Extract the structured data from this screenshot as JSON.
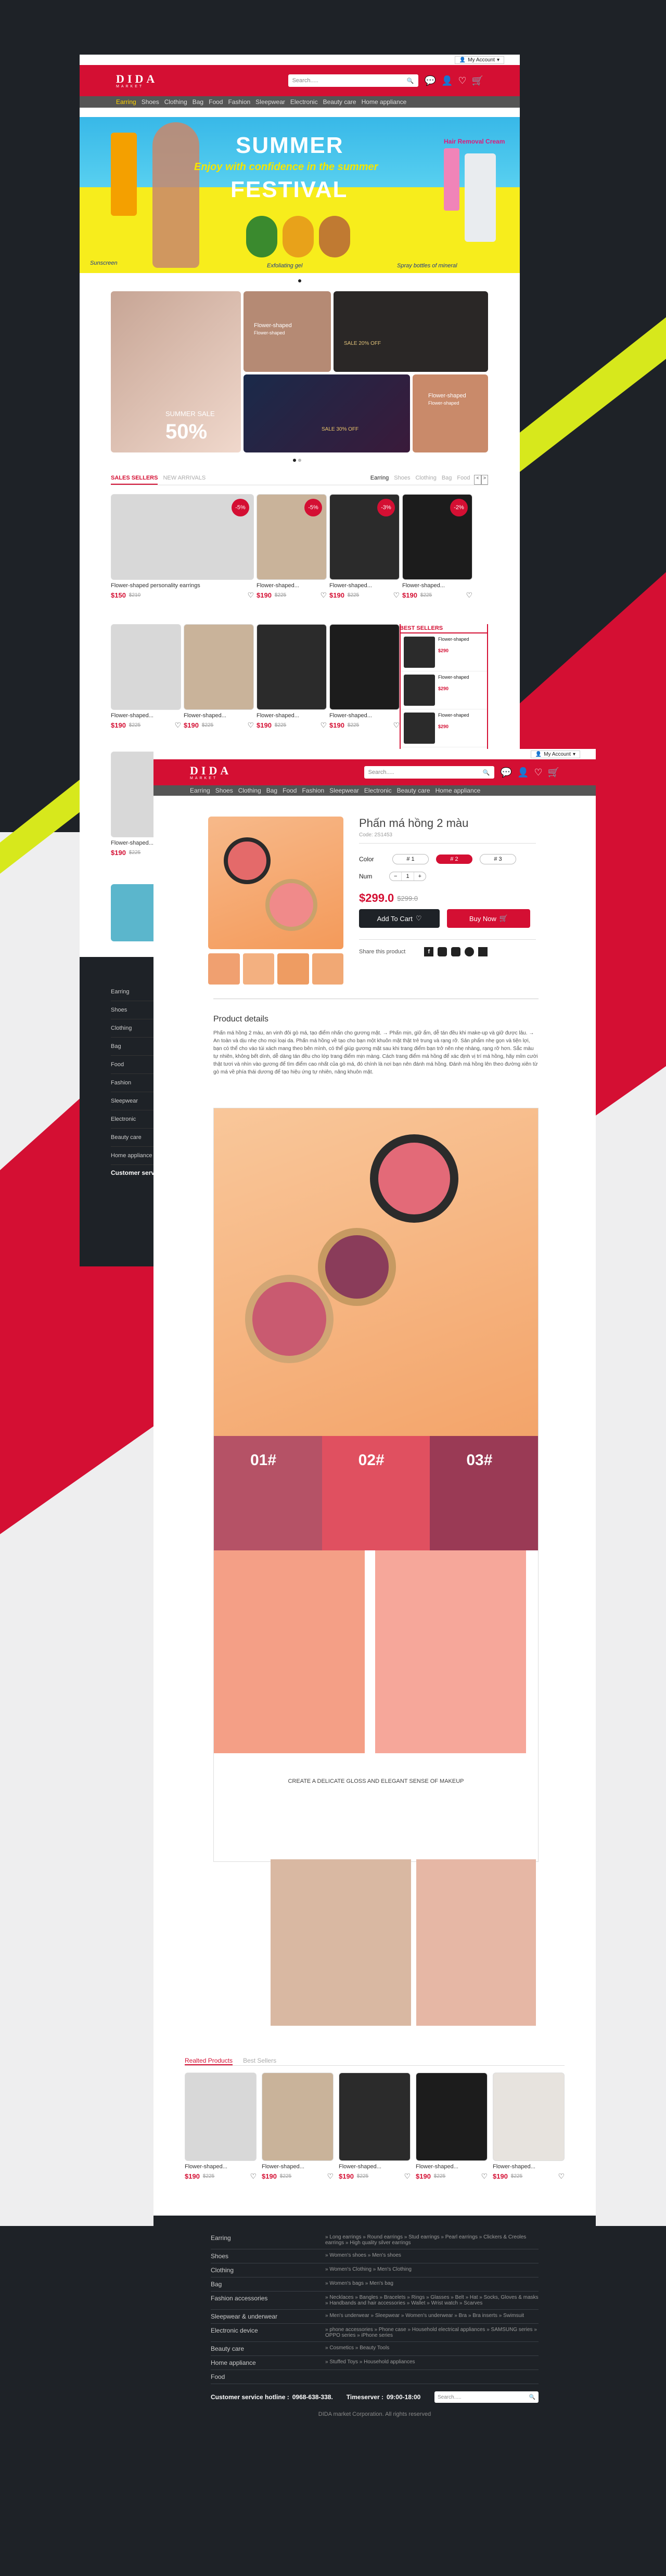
{
  "colors": {
    "brand": "#d40f33",
    "dark": "#1e2227",
    "nav": "#555555",
    "accent": "#ffd400"
  },
  "account": {
    "label": "My Account"
  },
  "logo": {
    "main": "DIDA",
    "sub": "MARKET"
  },
  "search": {
    "placeholder": "Search....."
  },
  "nav_items": [
    "Earring",
    "Shoes",
    "Clothing",
    "Bag",
    "Food",
    "Fashion",
    "Sleepwear",
    "Electronic",
    "Beauty care",
    "Home appliance"
  ],
  "icons": [
    "chat-icon",
    "user-icon",
    "heart-icon",
    "cart-icon",
    "search-icon"
  ],
  "banner": {
    "title1": "SUMMER",
    "subtitle": "Enjoy with confidence in the summer",
    "title2": "FESTIVAL",
    "right_caption": "Hair Removal Cream",
    "cap1": "Sunscreen",
    "cap2": "Exfoliating gel",
    "cap3": "Spray bottles of mineral"
  },
  "promos": {
    "summer_label": "SUMMER SALE",
    "summer_pct": "50%",
    "p2_title": "Flower-shaped",
    "p2_sub": "Flower-shaped",
    "p3": "SALE 20% OFF",
    "p4": "SALE 30% OFF",
    "p5_title": "Flower-shaped",
    "p5_sub": "Flower-shaped"
  },
  "home_tabs": {
    "left": [
      "SALES SELLERS",
      "NEW ARRIVALS"
    ],
    "right": [
      "Earring",
      "Shoes",
      "Clothing",
      "Bag",
      "Food"
    ]
  },
  "home_products": [
    {
      "name": "Flower-shaped personality earrings",
      "price": "$150",
      "old": "$210",
      "sale": "-5%"
    },
    {
      "name": "Flower-shaped...",
      "price": "$190",
      "old": "$225",
      "sale": "-5%"
    },
    {
      "name": "Flower-shaped...",
      "price": "$190",
      "old": "$225",
      "sale": "-3%"
    },
    {
      "name": "Flower-shaped...",
      "price": "$190",
      "old": "$225",
      "sale": "-2%"
    }
  ],
  "home_products2": [
    {
      "name": "Flower-shaped...",
      "price": "$190",
      "old": "$225"
    },
    {
      "name": "Flower-shaped...",
      "price": "$190",
      "old": "$225"
    },
    {
      "name": "Flower-shaped...",
      "price": "$190",
      "old": "$225"
    },
    {
      "name": "Flower-shaped...",
      "price": "$190",
      "old": "$225"
    }
  ],
  "home_products3": [
    {
      "name": "Flower-shaped...",
      "price": "$190",
      "old": "$225"
    }
  ],
  "best_sellers": {
    "title": "BEST SELLERS",
    "items": [
      {
        "name": "Flower-shaped",
        "price": "$290"
      },
      {
        "name": "Flower-shaped",
        "price": "$290"
      },
      {
        "name": "Flower-shaped",
        "price": "$290"
      }
    ]
  },
  "home_footer_cats": [
    "Earring",
    "Shoes",
    "Clothing",
    "Bag",
    "Food",
    "Fashion",
    "Sleepwear",
    "Electronic",
    "Beauty care",
    "Home appliance"
  ],
  "home_footer_hotline": "Customer service hotline",
  "product": {
    "name": "Phấn má hồng 2 màu",
    "code": "Code: 2S1453",
    "color_label": "Color",
    "colors": [
      "# 1",
      "# 2",
      "# 3"
    ],
    "num_label": "Num",
    "qty": "1",
    "price": "$299.0",
    "old": "$299.0",
    "add_to_cart": "Add To Cart",
    "buy_now": "Buy Now",
    "share": "Share this product",
    "details_title": "Product details",
    "details_text": "Phấn má hồng 2 màu, an vinh đôi gò má, tạo điểm nhấn cho gương mặt. → Phấn mịn, giữ ẩm, dễ tán đều khi make-up và giữ được lâu. → An toàn và dịu nhẹ cho mọi loại da. Phấn má hồng về tạo cho bạn một khuôn mặt thật trẻ trung và rạng rỡ. Sản phẩm nhẹ gọn và tiện lợi, bạn có thể cho vào túi xách mang theo bên mình, có thể giúp gương mặt sau khi trang điểm bạn trở nên nhẹ nhàng, rạng rỡ hơn. Sắc màu tự nhiên, không bết dính, dễ dàng tán đều cho lớp trang điểm mịn màng. Cách trang điểm má hồng để xác định vị trí má hồng, hãy mỉm cười thật tươi và nhìn vào gương để tìm điểm cao nhất của gò má, đó chính là nơi bạn nên đánh má hồng. Đánh má hồng lên theo đường xiên từ gò má về phía thái dương để tạo hiệu ứng tự nhiên, nâng khuôn mặt.",
    "swatches": [
      "01#",
      "02#",
      "03#"
    ],
    "caption": "CREATE A DELICATE GLOSS AND ELEGANT SENSE OF MAKEUP"
  },
  "related_tabs": [
    "Realted Products",
    "Best Sellers"
  ],
  "related": [
    {
      "name": "Flower-shaped...",
      "price": "$190",
      "old": "$225"
    },
    {
      "name": "Flower-shaped...",
      "price": "$190",
      "old": "$225"
    },
    {
      "name": "Flower-shaped...",
      "price": "$190",
      "old": "$225"
    },
    {
      "name": "Flower-shaped...",
      "price": "$190",
      "old": "$225"
    },
    {
      "name": "Flower-shaped...",
      "price": "$190",
      "old": "$225"
    }
  ],
  "footer": {
    "rows": [
      {
        "k": "Earring",
        "v": "» Long earrings   » Round earrings   » Stud earrings   » Pearl earrings   » Clickers & Creoles earrings   » High quality silver earrings"
      },
      {
        "k": "Shoes",
        "v": "» Women's shoes   » Men's shoes"
      },
      {
        "k": "Clothing",
        "v": "» Women's Clothing   » Men's Clothing"
      },
      {
        "k": "Bag",
        "v": "» Women's bags   » Men's bag"
      },
      {
        "k": "Fashion accessories",
        "v": "» Necklaces   » Bangles   » Bracelets   » Rings   » Glasses   » Belt   » Hat   » Socks, Gloves & masks   » Handbands and hair accessories   » Wallet   » Wrist watch   » Scarves"
      },
      {
        "k": "Sleepwear & underwear",
        "v": "» Men's underwear   » Sleepwear   » Women's underwear   » Bra   » Bra inserts   » Swimsuit"
      },
      {
        "k": "Electronic device",
        "v": "» phone accessories   » Phone case   » Household electrical appliances   » SAMSUNG series   » OPPO series   » iPhone series"
      },
      {
        "k": "Beauty care",
        "v": "» Cosmetics   » Beauty Tools"
      },
      {
        "k": "Home appliance",
        "v": "» Stuffed Toys   » Household appliances"
      },
      {
        "k": "Food",
        "v": ""
      }
    ],
    "hotline_label": "Customer service hotline : ",
    "hotline": "0968-638-338.",
    "timeserver_label": "Timeserver : ",
    "timeserver": "09:00-18:00",
    "search_placeholder": "Search.....",
    "copyright": "DIDA market Corporation. All rights reserved"
  }
}
